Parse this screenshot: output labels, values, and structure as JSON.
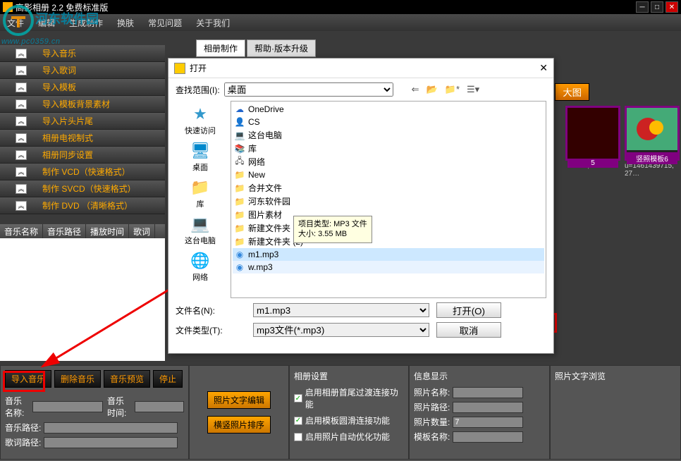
{
  "titlebar": {
    "title": "高影相册 2.2 免费标准版"
  },
  "watermark": {
    "text": "河东软件园",
    "url": "www.pc0359.cn"
  },
  "menubar": [
    "文件",
    "编辑",
    "生成制作",
    "换肤",
    "常见问题",
    "关于我们"
  ],
  "sidebar": {
    "items": [
      "导入音乐",
      "导入歌词",
      "导入模板",
      "导入模板背景素材",
      "导入片头片尾",
      "相册电视制式",
      "相册同步设置",
      "制作 VCD（快速格式）",
      "制作 SVCD（快速格式）",
      "制作 DVD （清晰格式）"
    ]
  },
  "tabs": [
    "相册制作",
    "帮助·版本升级"
  ],
  "enlarge_btn": "大图",
  "thumbs": [
    {
      "label": "5",
      "meta": "74, 19…"
    },
    {
      "label": "竖照模板6",
      "meta": "u=1461439715, 27…"
    }
  ],
  "list_header": [
    "音乐名称",
    "音乐路径",
    "播放时间",
    "歌词"
  ],
  "dialog": {
    "title": "打开",
    "look_label": "查找范围(I):",
    "look_value": "桌面",
    "places": [
      "快速访问",
      "桌面",
      "库",
      "这台电脑",
      "网络"
    ],
    "files": [
      {
        "name": "OneDrive",
        "type": "cloud"
      },
      {
        "name": "CS",
        "type": "user"
      },
      {
        "name": "这台电脑",
        "type": "pc"
      },
      {
        "name": "库",
        "type": "lib"
      },
      {
        "name": "网络",
        "type": "net"
      },
      {
        "name": "New",
        "type": "folder"
      },
      {
        "name": "合并文件",
        "type": "folder"
      },
      {
        "name": "河东软件园",
        "type": "folder"
      },
      {
        "name": "图片素材",
        "type": "folder"
      },
      {
        "name": "新建文件夹",
        "type": "folder"
      },
      {
        "name": "新建文件夹 (2)",
        "type": "folder"
      },
      {
        "name": "m1.mp3",
        "type": "mp3",
        "selected": true
      },
      {
        "name": "w.mp3",
        "type": "mp3"
      }
    ],
    "tooltip_line1": "项目类型: MP3 文件",
    "tooltip_line2": "大小: 3.55 MB",
    "filename_label": "文件名(N):",
    "filename_value": "m1.mp3",
    "filetype_label": "文件类型(T):",
    "filetype_value": "mp3文件(*.mp3)",
    "open_btn": "打开(O)",
    "cancel_btn": "取消"
  },
  "bottom": {
    "music_buttons": [
      "导入音乐",
      "删除音乐",
      "音乐预览",
      "停止"
    ],
    "music_fields": {
      "name": "音乐名称:",
      "time": "音乐时间:",
      "path": "音乐路径:",
      "lyric": "歌词路径:"
    },
    "edit_buttons": [
      "照片文字编辑",
      "横竖照片排序"
    ],
    "album": {
      "title": "相册设置",
      "c1": "启用相册首尾过渡连接功能",
      "c2": "启用模板圆滑连接功能",
      "c3": "启用照片自动优化功能"
    },
    "info": {
      "title": "信息显示",
      "photo_name": "照片名称:",
      "photo_path": "照片路径:",
      "photo_count": "照片数量:",
      "photo_count_val": "7",
      "template_name": "模板名称:"
    },
    "text_browse": {
      "title": "照片文字浏览"
    }
  }
}
